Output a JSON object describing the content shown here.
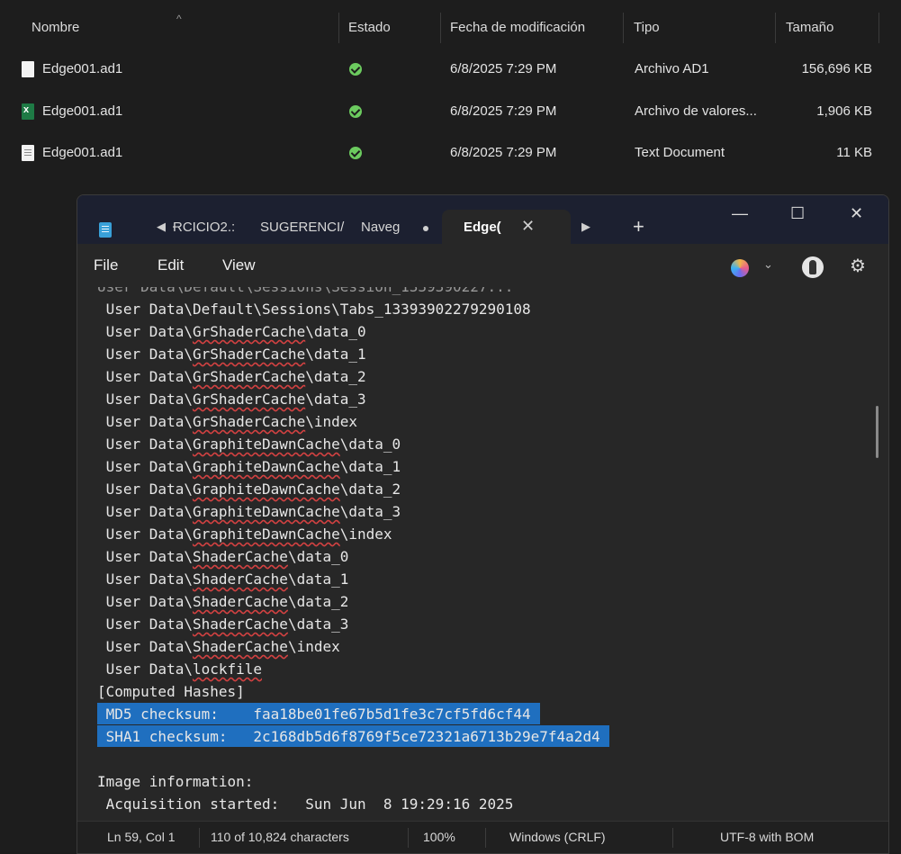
{
  "explorer": {
    "columns": [
      "Nombre",
      "Estado",
      "Fecha de modificación",
      "Tipo",
      "Tamaño"
    ],
    "files": [
      {
        "icon": "file-icon",
        "name": "Edge001.ad1",
        "status": "synced",
        "date": "6/8/2025 7:29 PM",
        "type": "Archivo AD1",
        "size": "156,696 KB"
      },
      {
        "icon": "excel-csv-icon",
        "name": "Edge001.ad1",
        "status": "synced",
        "date": "6/8/2025 7:29 PM",
        "type": "Archivo de valores...",
        "size": "1,906 KB"
      },
      {
        "icon": "text-document-icon",
        "name": "Edge001.ad1",
        "status": "synced",
        "date": "6/8/2025 7:29 PM",
        "type": "Text Document",
        "size": "11 KB"
      }
    ]
  },
  "notepad": {
    "tabs": [
      {
        "label": "ɌCICIO2.:"
      },
      {
        "label": "SUGERENCI/"
      },
      {
        "label": "Naveg"
      }
    ],
    "active_tab": "Edge(",
    "menu": [
      "File",
      "Edit",
      "View"
    ],
    "lines": [
      {
        "pre": "User Data\\Default\\Sessions\\Tabs_13393902279290108",
        "sq": "",
        "post": ""
      },
      {
        "pre": "User Data\\",
        "sq": "GrShaderCache",
        "post": "\\data_0"
      },
      {
        "pre": "User Data\\",
        "sq": "GrShaderCache",
        "post": "\\data_1"
      },
      {
        "pre": "User Data\\",
        "sq": "GrShaderCache",
        "post": "\\data_2"
      },
      {
        "pre": "User Data\\",
        "sq": "GrShaderCache",
        "post": "\\data_3"
      },
      {
        "pre": "User Data\\",
        "sq": "GrShaderCache",
        "post": "\\index"
      },
      {
        "pre": "User Data\\",
        "sq": "GraphiteDawnCache",
        "post": "\\data_0"
      },
      {
        "pre": "User Data\\",
        "sq": "GraphiteDawnCache",
        "post": "\\data_1"
      },
      {
        "pre": "User Data\\",
        "sq": "GraphiteDawnCache",
        "post": "\\data_2"
      },
      {
        "pre": "User Data\\",
        "sq": "GraphiteDawnCache",
        "post": "\\data_3"
      },
      {
        "pre": "User Data\\",
        "sq": "GraphiteDawnCache",
        "post": "\\index"
      },
      {
        "pre": "User Data\\",
        "sq": "ShaderCache",
        "post": "\\data_0"
      },
      {
        "pre": "User Data\\",
        "sq": "ShaderCache",
        "post": "\\data_1"
      },
      {
        "pre": "User Data\\",
        "sq": "ShaderCache",
        "post": "\\data_2"
      },
      {
        "pre": "User Data\\",
        "sq": "ShaderCache",
        "post": "\\data_3"
      },
      {
        "pre": "User Data\\",
        "sq": "ShaderCache",
        "post": "\\index"
      },
      {
        "pre": "User Data\\",
        "sq": "lockfile",
        "post": ""
      },
      {
        "pre": "[Computed Hashes]",
        "sq": "",
        "post": ""
      },
      {
        "pre": " MD5 checksum:    faa18be01fe67b5d1fe3c7cf5fd6cf44",
        "sq": "",
        "post": "",
        "hl": true
      },
      {
        "pre": " SHA1 checksum:   2c168db5d6f8769f5ce72321a6713b29e7f4a2d4",
        "sq": "",
        "post": "",
        "hl": true
      },
      {
        "pre": "",
        "sq": "",
        "post": ""
      },
      {
        "pre": "Image information:",
        "sq": "",
        "post": ""
      },
      {
        "pre": " Acquisition started:   Sun Jun  8 19:29:16 2025",
        "sq": "",
        "post": ""
      }
    ],
    "status": {
      "position": "Ln 59, Col 1",
      "chars": "110 of 10,824 characters",
      "zoom": "100%",
      "eol": "Windows (CRLF)",
      "encoding": "UTF-8 with BOM"
    }
  }
}
